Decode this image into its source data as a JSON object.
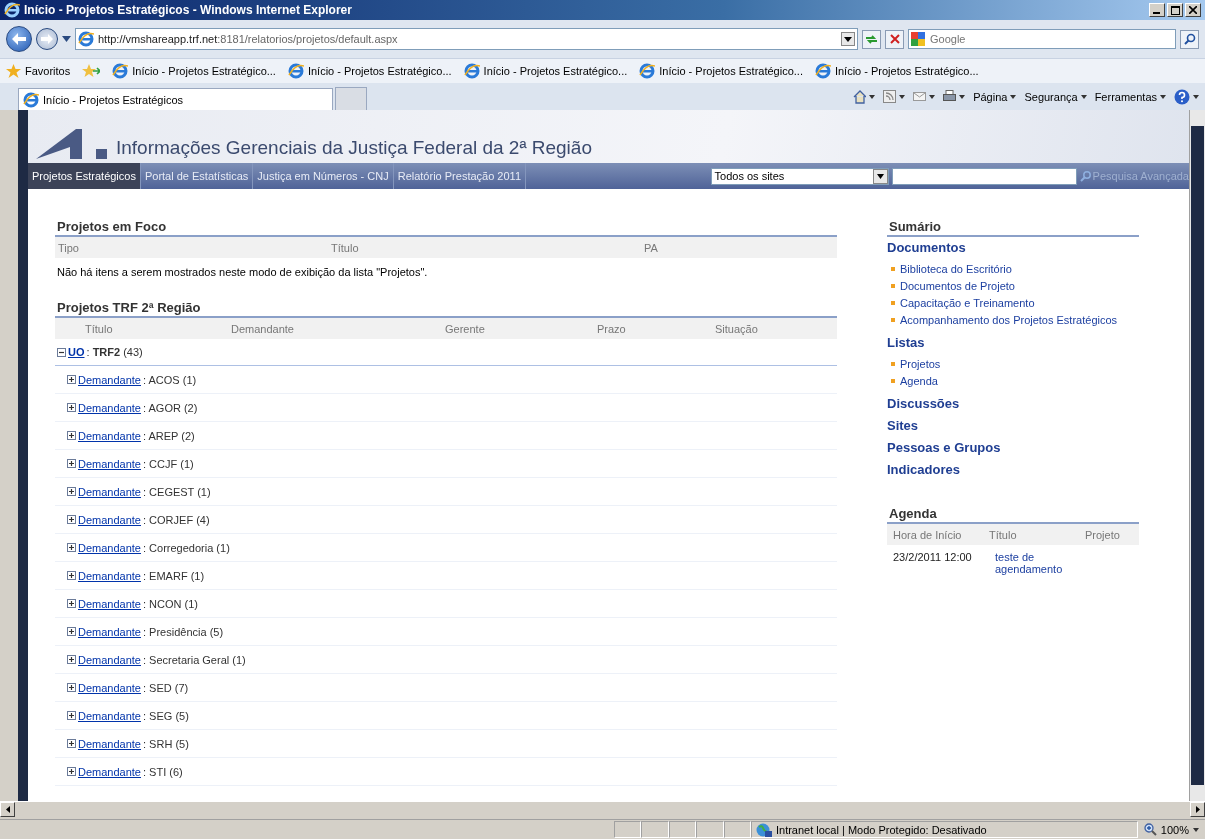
{
  "window": {
    "title": "Início - Projetos Estratégicos - Windows Internet Explorer"
  },
  "address_bar": {
    "url_host": "http://vmshareapp.trf.net",
    "url_path": ":8181/relatorios/projetos/default.aspx",
    "search_placeholder": "Google"
  },
  "favorites_bar": {
    "label": "Favoritos",
    "items": [
      "Início - Projetos Estratégico...",
      "Início - Projetos Estratégico...",
      "Início - Projetos Estratégico...",
      "Início - Projetos Estratégico...",
      "Início - Projetos Estratégico..."
    ]
  },
  "tabs": [
    {
      "label": "Início - Projetos Estratégicos",
      "selected": true
    }
  ],
  "command_bar": [
    "Página",
    "Segurança",
    "Ferramentas"
  ],
  "site": {
    "title": "Informações Gerenciais da Justiça Federal da 2ª Região",
    "nav": [
      {
        "label": "Projetos Estratégicos",
        "selected": true
      },
      {
        "label": "Portal de Estatísticas",
        "selected": false
      },
      {
        "label": "Justiça em Números - CNJ",
        "selected": false
      },
      {
        "label": "Relatório Prestação 2011",
        "selected": false
      }
    ],
    "scope": "Todos os sites",
    "advanced_search": "Pesquisa Avançada"
  },
  "projetos_em_foco": {
    "title": "Projetos em Foco",
    "columns": [
      "Tipo",
      "Título",
      "PA"
    ],
    "empty_message": "Não há itens a serem mostrados neste modo de exibição da lista \"Projetos\"."
  },
  "projetos_trf": {
    "title": "Projetos TRF 2ª Região",
    "columns": [
      "Título",
      "Demandante",
      "Gerente",
      "Prazo",
      "Situação"
    ],
    "group": {
      "field": "UO",
      "rest": ": **TRF2** (43)",
      "expanded": true,
      "children": [
        {
          "field": "Demandante",
          "rest": ": ACOS (1)",
          "expanded": false
        },
        {
          "field": "Demandante",
          "rest": ": AGOR (2)",
          "expanded": false
        },
        {
          "field": "Demandante",
          "rest": ": AREP (2)",
          "expanded": false
        },
        {
          "field": "Demandante",
          "rest": ": CCJF (1)",
          "expanded": false
        },
        {
          "field": "Demandante",
          "rest": ": CEGEST (1)",
          "expanded": false
        },
        {
          "field": "Demandante",
          "rest": ": CORJEF (4)",
          "expanded": false
        },
        {
          "field": "Demandante",
          "rest": ": Corregedoria (1)",
          "expanded": false
        },
        {
          "field": "Demandante",
          "rest": ": EMARF (1)",
          "expanded": false
        },
        {
          "field": "Demandante",
          "rest": ": NCON (1)",
          "expanded": false
        },
        {
          "field": "Demandante",
          "rest": ": Presidência (5)",
          "expanded": false
        },
        {
          "field": "Demandante",
          "rest": ": Secretaria Geral (1)",
          "expanded": false
        },
        {
          "field": "Demandante",
          "rest": ": SED (7)",
          "expanded": false
        },
        {
          "field": "Demandante",
          "rest": ": SEG (5)",
          "expanded": false
        },
        {
          "field": "Demandante",
          "rest": ": SRH (5)",
          "expanded": false
        },
        {
          "field": "Demandante",
          "rest": ": STI (6)",
          "expanded": false
        }
      ]
    }
  },
  "sumario": {
    "title": "Sumário",
    "sections": [
      {
        "heading": "Documentos",
        "links": [
          "Biblioteca do Escritório",
          "Documentos de Projeto",
          "Capacitação e Treinamento",
          "Acompanhamento dos Projetos Estratégicos"
        ]
      },
      {
        "heading": "Listas",
        "links": [
          "Projetos",
          "Agenda"
        ]
      },
      {
        "heading": "Discussões"
      },
      {
        "heading": "Sites"
      },
      {
        "heading": "Pessoas e Grupos"
      },
      {
        "heading": "Indicadores"
      }
    ]
  },
  "agenda": {
    "title": "Agenda",
    "columns": [
      "Hora de Início",
      "Título",
      "Projeto"
    ],
    "rows": [
      {
        "start": "23/2/2011 12:00",
        "title": "teste de agendamento"
      }
    ]
  },
  "status_bar": {
    "zone": "Intranet local | Modo Protegido: Desativado",
    "zoom": "100%"
  }
}
